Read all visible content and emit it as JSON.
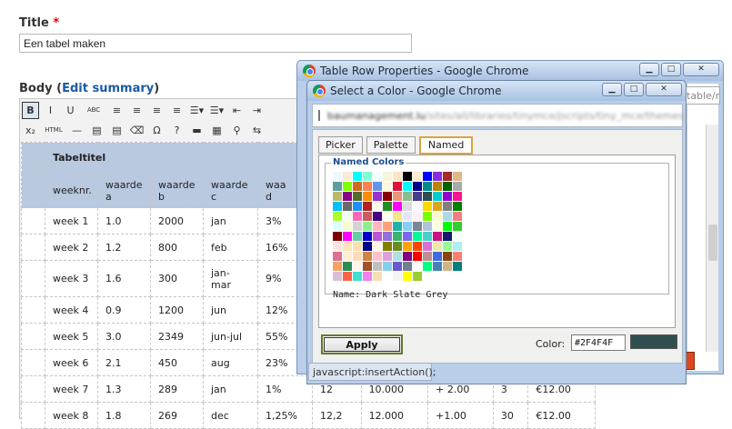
{
  "form": {
    "title_label": "Title",
    "required_mark": "*",
    "title_value": "Een tabel maken",
    "body_label": "Body",
    "body_paren_open": "(",
    "edit_summary_link": "Edit summary",
    "body_paren_close": ")"
  },
  "toolbar": {
    "row1": [
      {
        "name": "bold-button",
        "glyph": "B",
        "active": true
      },
      {
        "name": "italic-button",
        "glyph": "I"
      },
      {
        "name": "underline-button",
        "glyph": "U"
      },
      {
        "name": "strikethrough-button",
        "glyph": "ABC"
      },
      {
        "name": "align-left-button",
        "glyph": "≡"
      },
      {
        "name": "align-center-button",
        "glyph": "≡"
      },
      {
        "name": "align-right-button",
        "glyph": "≡"
      },
      {
        "name": "align-justify-button",
        "glyph": "≡"
      },
      {
        "name": "bullet-list-button",
        "glyph": "☰▾"
      },
      {
        "name": "numbered-list-button",
        "glyph": "☰▾"
      },
      {
        "name": "outdent-button",
        "glyph": "⇤"
      },
      {
        "name": "indent-button",
        "glyph": "⇥"
      }
    ],
    "row2": [
      {
        "name": "subscript-button",
        "glyph": "x₂"
      },
      {
        "name": "html-button",
        "glyph": "HTML"
      },
      {
        "name": "horizontal-rule-button",
        "glyph": "—"
      },
      {
        "name": "paste-text-button",
        "glyph": "▤"
      },
      {
        "name": "paste-word-button",
        "glyph": "▤"
      },
      {
        "name": "cleanup-button",
        "glyph": "⌫"
      },
      {
        "name": "special-char-button",
        "glyph": "Ω"
      },
      {
        "name": "help-button",
        "glyph": "?"
      },
      {
        "name": "minus-button",
        "glyph": "▬"
      },
      {
        "name": "table-button",
        "glyph": "▦"
      },
      {
        "name": "find-button",
        "glyph": "⚲"
      },
      {
        "name": "replace-button",
        "glyph": "⇆"
      }
    ]
  },
  "table": {
    "caption": "Tabeltitel",
    "headers": [
      [
        "weeknr."
      ],
      [
        "waarde",
        "a"
      ],
      [
        "waarde",
        "b"
      ],
      [
        "waarde",
        "c"
      ],
      [
        "waa",
        "d"
      ]
    ],
    "rows": [
      {
        "cells": [
          "week 1",
          "1.0",
          "2000",
          "jan",
          "3%"
        ]
      },
      {
        "cells": [
          "week 2",
          "1.2",
          "800",
          "feb",
          "16%"
        ]
      },
      {
        "cells": [
          "week 3",
          "1.6",
          "300",
          "jan-\nmar",
          "9%"
        ]
      },
      {
        "cells": [
          "week 4",
          "0.9",
          "1200",
          "jun",
          "12%"
        ]
      },
      {
        "cells": [
          "week 5",
          "3.0",
          "2349",
          "jun-jul",
          "55%"
        ]
      },
      {
        "cells": [
          "week 6",
          "2.1",
          "450",
          "aug",
          "23%"
        ]
      },
      {
        "cells": [
          "week 7",
          "1.3",
          "289",
          "jan",
          "1%",
          "12",
          "10.000",
          "+ 2.00",
          "3",
          "€12.00"
        ]
      },
      {
        "cells": [
          "week 8",
          "1.8",
          "269",
          "dec",
          "1,25%",
          "12,2",
          "12.000",
          "+1.00",
          "30",
          "€12.00"
        ]
      }
    ]
  },
  "back_window": {
    "title": "Table Row Properties - Google Chrome",
    "address_fragment": "table/r"
  },
  "color_window": {
    "title": "Select a Color - Google Chrome",
    "address_host": "baumanagement.lu",
    "address_path": "/sites/all/libraries/tinymce/jscripts/tiny_mce/themes",
    "tabs": [
      "Picker",
      "Palette",
      "Named"
    ],
    "selected_tab": "Named",
    "legend": "Named Colors",
    "swatches": [
      "#f0f8ff",
      "#faebd7",
      "#00ffff",
      "#7fffd4",
      "#f0ffff",
      "#f5f5dc",
      "#ffe4c4",
      "#000000",
      "#ffebcd",
      "#0000ff",
      "#8a2be2",
      "#a52a2a",
      "#deb887",
      "#5f9ea0",
      "#7fff00",
      "#d2691e",
      "#ff7f50",
      "#6495ed",
      "#fff8dc",
      "#dc143c",
      "#00ffff",
      "#00008b",
      "#008b8b",
      "#b8860b",
      "#006400",
      "#a9a9a9",
      "#bdb76b",
      "#8b008b",
      "#556b2f",
      "#ff8c00",
      "#9932cc",
      "#8b0000",
      "#e9967a",
      "#8fbc8f",
      "#483d8b",
      "#2f4f4f",
      "#00ced1",
      "#9400d3",
      "#ff1493",
      "#00bfff",
      "#696969",
      "#1e90ff",
      "#b22222",
      "#fffaf0",
      "#228b22",
      "#ff00ff",
      "#dcdcdc",
      "#f8f8ff",
      "#ffd700",
      "#daa520",
      "#808080",
      "#008000",
      "#adff2f",
      "#f0fff0",
      "#ff69b4",
      "#cd5c5c",
      "#4b0082",
      "#fffff0",
      "#f0e68c",
      "#e6e6fa",
      "#fff0f5",
      "#7cfc00",
      "#fffacd",
      "#add8e6",
      "#f08080",
      "#e0ffff",
      "#fafad2",
      "#d3d3d3",
      "#90ee90",
      "#ffb6c1",
      "#ffa07a",
      "#20b2aa",
      "#87cefa",
      "#778899",
      "#b0c4de",
      "#ffffe0",
      "#00ff00",
      "#32cd32",
      "#800000",
      "#ff00ff",
      "#66cdaa",
      "#0000cd",
      "#ba55d3",
      "#9370db",
      "#3cb371",
      "#7b68ee",
      "#00fa9a",
      "#48d1cc",
      "#c71585",
      "#191970",
      "#f5fffa",
      "#ffe4e1",
      "#ffe4b5",
      "#ffdead",
      "#000080",
      "#fdf5e6",
      "#808000",
      "#6b8e23",
      "#ffa500",
      "#ff4500",
      "#da70d6",
      "#eee8aa",
      "#98fb98",
      "#afeeee",
      "#db7093",
      "#ffefd5",
      "#ffdab9",
      "#cd853f",
      "#ffc0cb",
      "#dda0dd",
      "#b0e0e6",
      "#800080",
      "#ff0000",
      "#bc8f8f",
      "#4169e1",
      "#8b4513",
      "#fa8072",
      "#f4a460",
      "#2e8b57",
      "#fff5ee",
      "#a0522d",
      "#c0c0c0",
      "#87ceeb",
      "#6a5acd",
      "#708090",
      "#fffafa",
      "#00ff7f",
      "#4682b4",
      "#d2b48c",
      "#008080",
      "#d8bfd8",
      "#ff6347",
      "#40e0d0",
      "#ee82ee",
      "#f5deb3",
      "#ffffff",
      "#f5f5f5",
      "#ffff00",
      "#9acd32"
    ],
    "name_label": "Name: Dark Slate Grey",
    "apply_label": "Apply",
    "color_label": "Color:",
    "color_value": "#2F4F4F",
    "preview_color": "#2f4f4f",
    "status_text": "javascript:insertAction();"
  }
}
